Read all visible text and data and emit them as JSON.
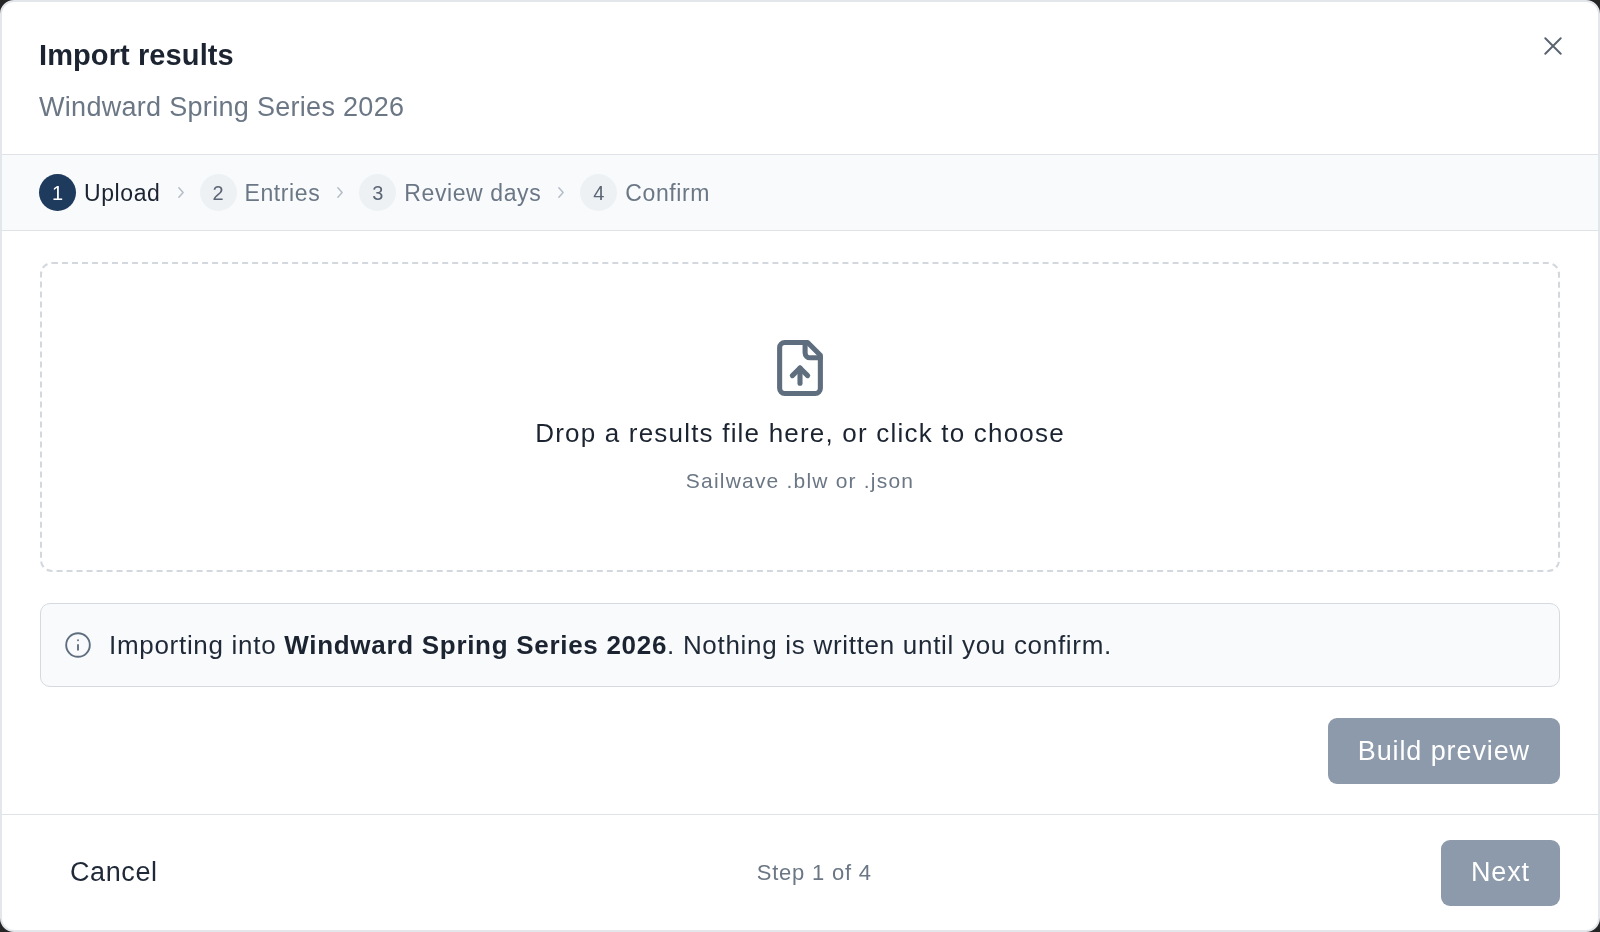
{
  "dialog": {
    "title": "Import results",
    "subtitle": "Windward Spring Series 2026"
  },
  "steps": [
    {
      "number": "1",
      "label": "Upload",
      "selected": true
    },
    {
      "number": "2",
      "label": "Entries",
      "selected": false
    },
    {
      "number": "3",
      "label": "Review days",
      "selected": false
    },
    {
      "number": "4",
      "label": "Confirm",
      "selected": false
    }
  ],
  "dropzone": {
    "prompt": "Drop a results file here, or click to choose",
    "hint": "Sailwave .blw or .json"
  },
  "notice": {
    "text": "Importing into **Windward Spring Series 2026**. Nothing is written until you confirm."
  },
  "build_button": {
    "label": "Build preview",
    "disabled": true
  },
  "footer": {
    "cancel_label": "Cancel",
    "step_status": "Step 1 of 4",
    "next_button": {
      "label": "Next",
      "disabled": true
    }
  }
}
